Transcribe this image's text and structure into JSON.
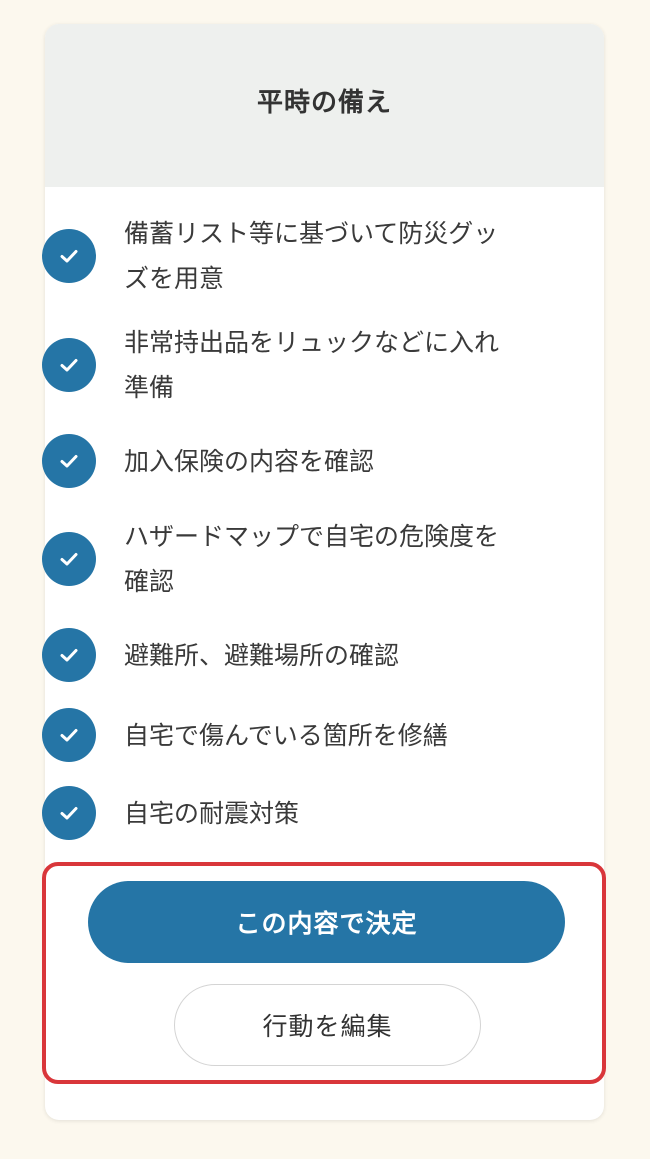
{
  "card": {
    "title": "平時の備え"
  },
  "checklist": {
    "items": [
      {
        "label": "備蓄リスト等に基づいて防災グッズを用意",
        "checked": true
      },
      {
        "label": "非常持出品をリュックなどに入れ準備",
        "checked": true
      },
      {
        "label": "加入保険の内容を確認",
        "checked": true
      },
      {
        "label": "ハザードマップで自宅の危険度を確認",
        "checked": true
      },
      {
        "label": "避難所、避難場所の確認",
        "checked": true
      },
      {
        "label": "自宅で傷んでいる箇所を修繕",
        "checked": true
      },
      {
        "label": "自宅の耐震対策",
        "checked": true
      }
    ]
  },
  "actions": {
    "confirm_label": "この内容で決定",
    "edit_label": "行動を編集"
  },
  "colors": {
    "accent": "#2575a6",
    "header_bg": "#eef0ee",
    "page_bg": "#fcf8ee",
    "highlight_border": "#d9363a"
  }
}
